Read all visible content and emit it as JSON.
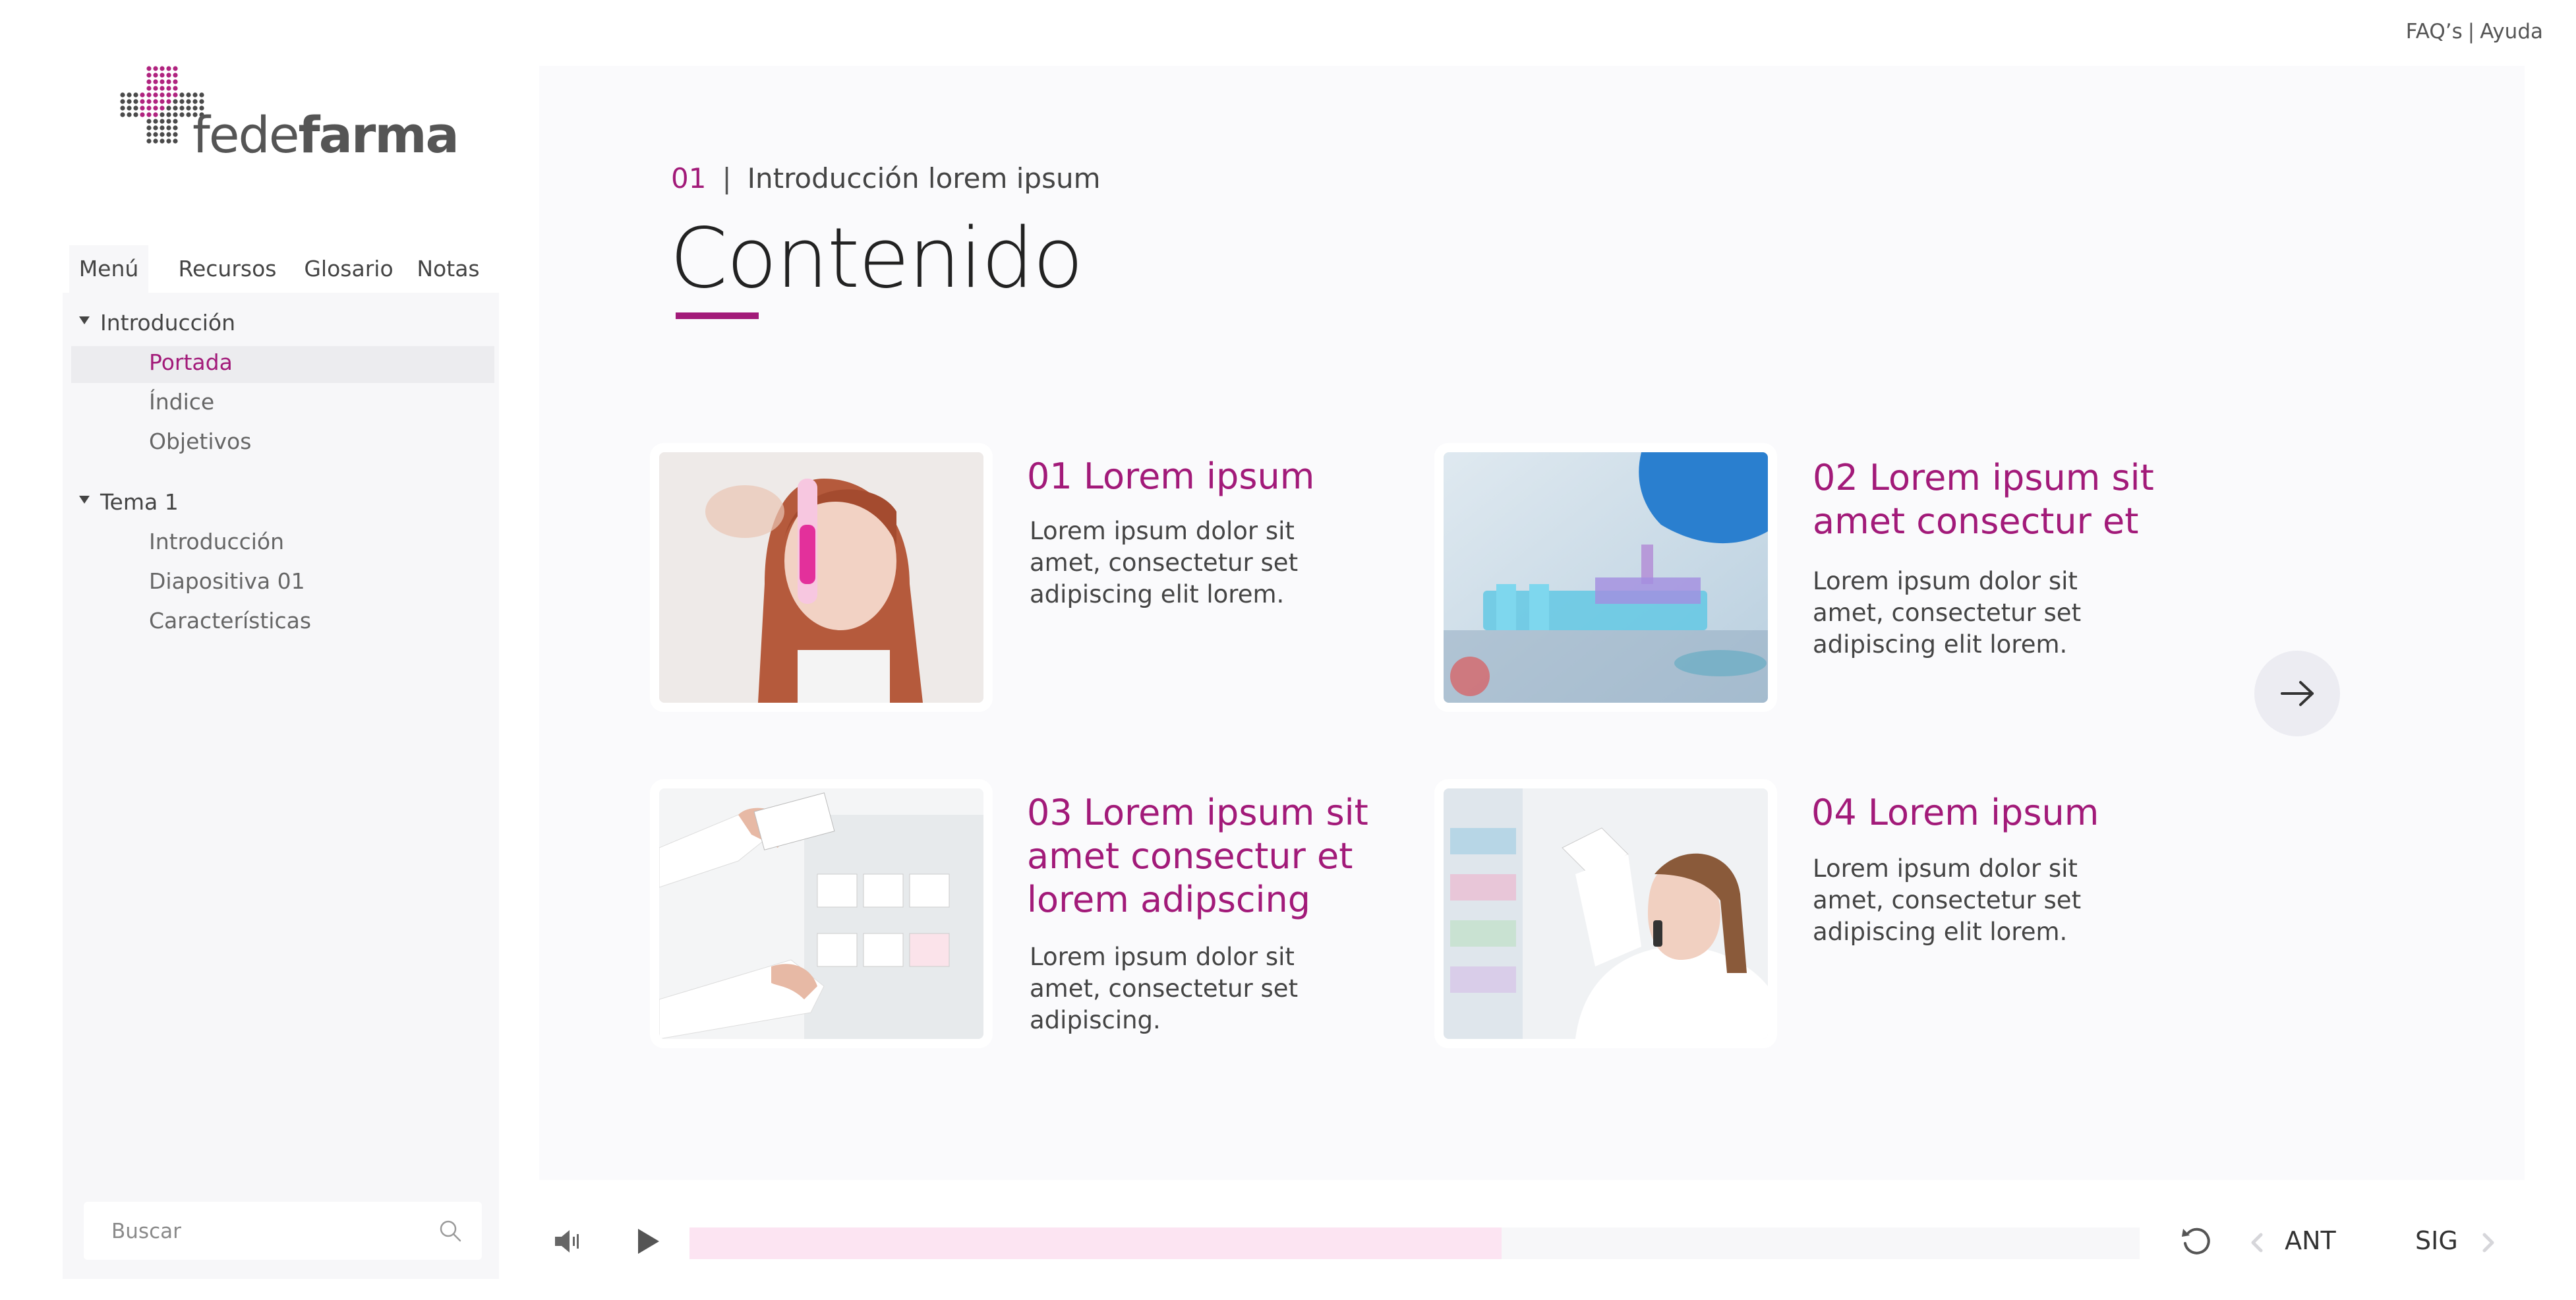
{
  "toplinks": {
    "faq": "FAQ’s",
    "separator": "|",
    "help": "Ayuda"
  },
  "logo": {
    "text_light": "fede",
    "text_bold": "farma"
  },
  "tabs": [
    "Menú",
    "Recursos",
    "Glosario",
    "Notas"
  ],
  "menu": {
    "sections": [
      {
        "label": "Introducción",
        "items": [
          "Portada",
          "Índice",
          "Objetivos"
        ]
      },
      {
        "label": "Tema 1",
        "items": [
          "Introducción",
          "Diapositiva 01",
          "Características"
        ]
      }
    ],
    "active_item": "Portada"
  },
  "search": {
    "placeholder": "Buscar"
  },
  "header": {
    "number": "01",
    "separator": "|",
    "section": "Introducción lorem ipsum",
    "title": "Contenido"
  },
  "cards": [
    {
      "title": "01 Lorem ipsum",
      "text": "Lorem ipsum dolor sit amet, consectetur set adipiscing elit lorem."
    },
    {
      "title": "02 Lorem ipsum sit amet consectur et",
      "text": "Lorem ipsum dolor sit amet, consectetur set adipiscing elit lorem."
    },
    {
      "title": "03 Lorem ipsum sit amet consectur et lorem adipscing",
      "text": "Lorem ipsum dolor sit amet, consectetur set adipiscing."
    },
    {
      "title": "04 Lorem ipsum",
      "text": "Lorem ipsum dolor sit amet, consectetur set adipiscing elit lorem."
    }
  ],
  "player": {
    "progress_fraction": 0.56,
    "prev_label": "ANT",
    "next_label": "SIG"
  },
  "colors": {
    "accent": "#a21a79",
    "progress_fill": "#fce4f2",
    "panel": "#fafafc",
    "sidebar": "#f7f7f9"
  },
  "icons": [
    "logo-dots",
    "triangle-down-icon",
    "search-icon",
    "arrow-right-icon",
    "volume-icon",
    "play-icon",
    "replay-icon",
    "chevron-left-icon",
    "chevron-right-icon"
  ]
}
